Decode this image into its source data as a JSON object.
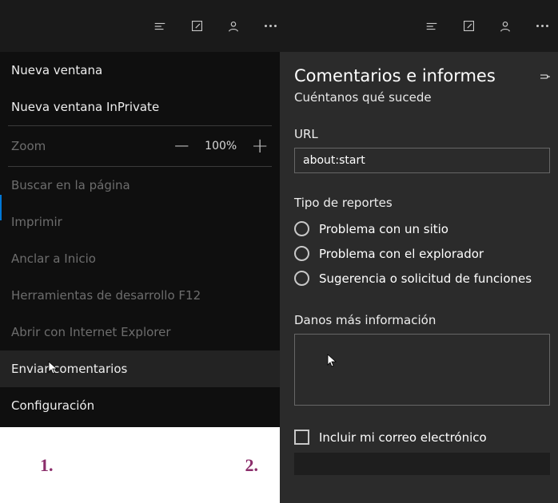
{
  "topbar": {
    "left_icons": [
      "menu-icon",
      "edit-icon",
      "profile-icon",
      "more-icon"
    ],
    "right_icons": [
      "menu-icon",
      "edit-icon",
      "profile-icon",
      "more-icon"
    ]
  },
  "menu": {
    "new_window": "Nueva ventana",
    "new_inprivate": "Nueva ventana InPrivate",
    "zoom_label": "Zoom",
    "zoom_value": "100%",
    "find": "Buscar en la página",
    "print": "Imprimir",
    "pin_start": "Anclar a Inicio",
    "dev_tools": "Herramientas de desarrollo F12",
    "open_ie": "Abrir con Internet Explorer",
    "feedback": "Enviar comentarios",
    "settings": "Configuración"
  },
  "footer": {
    "one": "1.",
    "two": "2."
  },
  "feedback": {
    "title": "Comentarios e informes",
    "subtitle": "Cuéntanos qué sucede",
    "url_label": "URL",
    "url_value": "about:start",
    "report_label": "Tipo de reportes",
    "options": [
      "Problema con un sitio",
      "Problema con el explorador",
      "Sugerencia o solicitud de funciones"
    ],
    "more_label": "Danos más información",
    "include_email": "Incluir mi correo electrónico"
  }
}
